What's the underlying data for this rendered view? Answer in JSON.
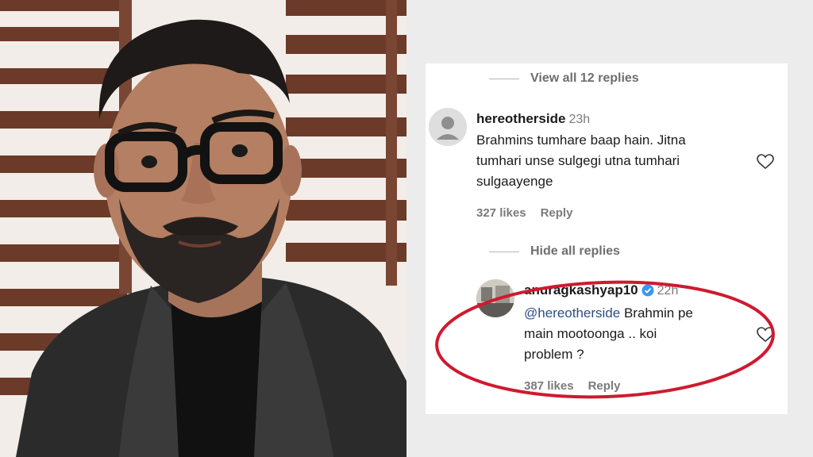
{
  "thread": {
    "view_replies": "View all 12 replies",
    "hide_replies": "Hide all replies"
  },
  "comment": {
    "username": "hereotherside",
    "time": "23h",
    "text_lines": [
      "Brahmins tumhare baap hain. Jitna",
      "tumhari unse sulgegi utna tumhari",
      "sulgaayenge"
    ],
    "likes": "327 likes",
    "reply": "Reply"
  },
  "reply": {
    "username": "anuragkashyap10",
    "time": "22h",
    "mention": "@hereotherside",
    "text_first": "Brahmin pe",
    "text_lines": [
      "main mootoonga .. koi",
      "problem ?"
    ],
    "likes": "387 likes",
    "reply": "Reply",
    "highlight_color": "#cf1a2f"
  },
  "icons": {
    "heart": "heart-icon",
    "verified": "verified-badge-icon",
    "avatar_default": "default-avatar-icon"
  }
}
